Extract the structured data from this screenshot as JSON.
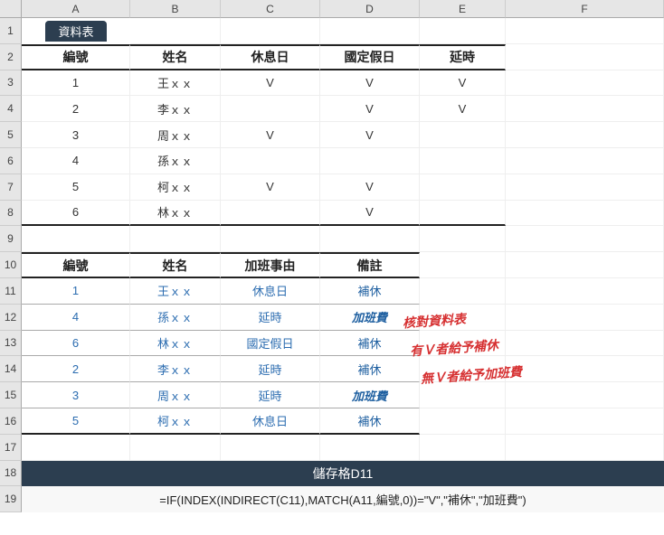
{
  "columns": [
    "A",
    "B",
    "C",
    "D",
    "E",
    "F"
  ],
  "rows": [
    "1",
    "2",
    "3",
    "4",
    "5",
    "6",
    "7",
    "8",
    "9",
    "10",
    "11",
    "12",
    "13",
    "14",
    "15",
    "16",
    "17",
    "18",
    "19"
  ],
  "tab_label": "資料表",
  "table1": {
    "headers": [
      "編號",
      "姓名",
      "休息日",
      "國定假日",
      "延時"
    ],
    "rows": [
      {
        "id": "1",
        "name": "王ｘｘ",
        "c": "V",
        "d": "V",
        "e": "V"
      },
      {
        "id": "2",
        "name": "李ｘｘ",
        "c": "",
        "d": "V",
        "e": "V"
      },
      {
        "id": "3",
        "name": "周ｘｘ",
        "c": "V",
        "d": "V",
        "e": ""
      },
      {
        "id": "4",
        "name": "孫ｘｘ",
        "c": "",
        "d": "",
        "e": ""
      },
      {
        "id": "5",
        "name": "柯ｘｘ",
        "c": "V",
        "d": "V",
        "e": ""
      },
      {
        "id": "6",
        "name": "林ｘｘ",
        "c": "",
        "d": "V",
        "e": ""
      }
    ]
  },
  "table2": {
    "headers": [
      "編號",
      "姓名",
      "加班事由",
      "備註"
    ],
    "rows": [
      {
        "id": "1",
        "name": "王ｘｘ",
        "reason": "休息日",
        "note": "補休"
      },
      {
        "id": "4",
        "name": "孫ｘｘ",
        "reason": "延時",
        "note": "加班費"
      },
      {
        "id": "6",
        "name": "林ｘｘ",
        "reason": "國定假日",
        "note": "補休"
      },
      {
        "id": "2",
        "name": "李ｘｘ",
        "reason": "延時",
        "note": "補休"
      },
      {
        "id": "3",
        "name": "周ｘｘ",
        "reason": "延時",
        "note": "加班費"
      },
      {
        "id": "5",
        "name": "柯ｘｘ",
        "reason": "休息日",
        "note": "補休"
      }
    ]
  },
  "annotations": {
    "line1": "核對資料表",
    "line2": "有Ｖ者給予補休",
    "line3": "無Ｖ者給予加班費"
  },
  "formula_title": "儲存格D11",
  "formula_text": "=IF(INDEX(INDIRECT(C11),MATCH(A11,編號,0))=\"V\",\"補休\",\"加班費\")"
}
